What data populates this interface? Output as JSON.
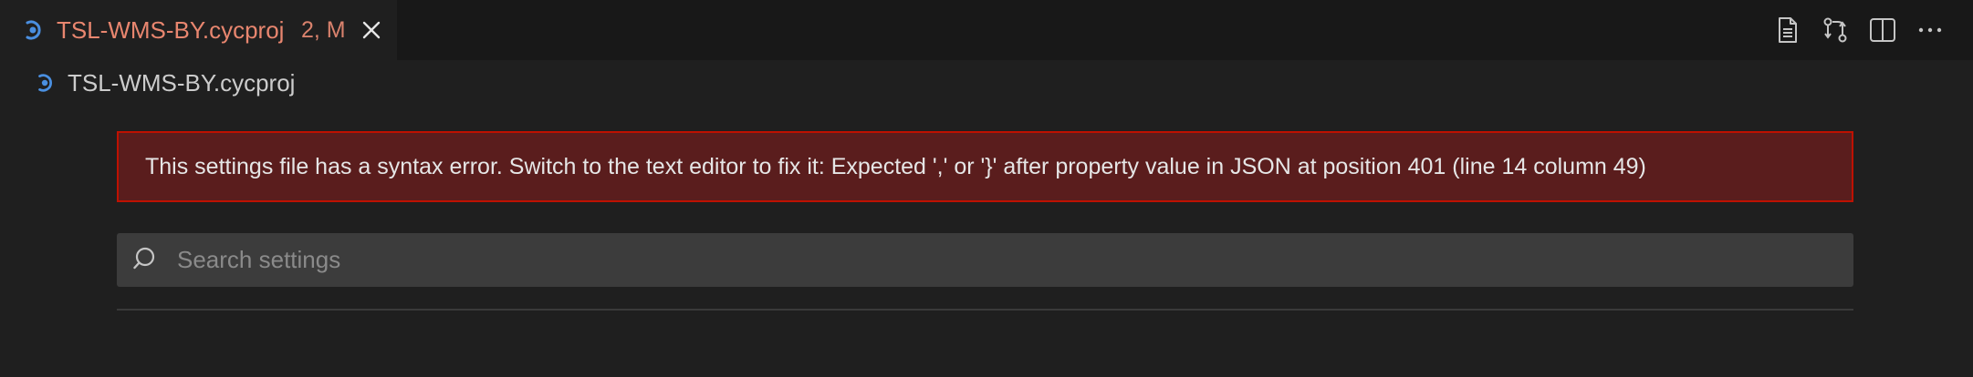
{
  "tab": {
    "title": "TSL-WMS-BY.cycproj",
    "badge": "2, M"
  },
  "breadcrumb": {
    "label": "TSL-WMS-BY.cycproj"
  },
  "error": {
    "message": "This settings file has a syntax error. Switch to the text editor to fix it: Expected ',' or '}' after property value in JSON at position 401 (line 14 column 49)"
  },
  "search": {
    "placeholder": "Search settings",
    "value": ""
  },
  "colors": {
    "tab_title": "#e8866f",
    "error_background": "#5a1d1d",
    "error_border": "#be1100",
    "icon_accent": "#4a8fe0"
  },
  "icons": {
    "tab": "settings-file-icon",
    "close": "close-icon",
    "open_json": "open-settings-json-icon",
    "compare": "compare-changes-icon",
    "split": "split-editor-icon",
    "more": "more-actions-icon",
    "search": "search-icon"
  }
}
